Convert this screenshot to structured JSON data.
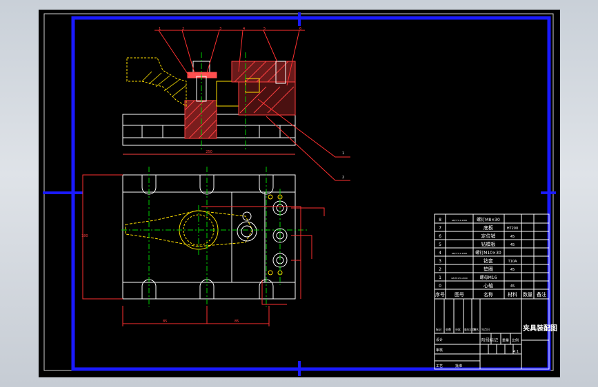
{
  "drawing": {
    "title_block": {
      "drawing_name": "夹具装配图",
      "header": [
        "序号",
        "图号",
        "名称",
        "材料",
        "数量",
        "备注"
      ],
      "parts": [
        {
          "no": "8",
          "code": "GB/T70.1-2000",
          "name": "螺钉M8×30",
          "material": ""
        },
        {
          "no": "7",
          "code": "",
          "name": "底板",
          "material": "HT200"
        },
        {
          "no": "6",
          "code": "",
          "name": "定位销",
          "material": "45"
        },
        {
          "no": "5",
          "code": "",
          "name": "钻模板",
          "material": "45"
        },
        {
          "no": "4",
          "code": "GB/T70.1-2000",
          "name": "螺钉M10×30",
          "material": ""
        },
        {
          "no": "3",
          "code": "",
          "name": "钻套",
          "material": "T10A"
        },
        {
          "no": "2",
          "code": "",
          "name": "垫圈",
          "material": "45"
        },
        {
          "no": "1",
          "code": "GB/T6170-2000",
          "name": "螺母M16",
          "material": ""
        },
        {
          "no": "0",
          "code": "",
          "name": "心轴",
          "material": "45"
        }
      ],
      "lower": {
        "row_labels": [
          "标记",
          "处数",
          "分区",
          "更改文件号",
          "签名",
          "年月日"
        ],
        "design": "设计",
        "review": "审核",
        "process": "工艺",
        "approve": "批准",
        "stage_label": "阶段标记",
        "weight_label": "重量",
        "scale_label": "比例",
        "scale_value": "4:1"
      }
    },
    "leader_labels": [
      "1",
      "2",
      "3",
      "4",
      "5",
      "6"
    ],
    "callouts": [
      "1",
      "2"
    ]
  }
}
